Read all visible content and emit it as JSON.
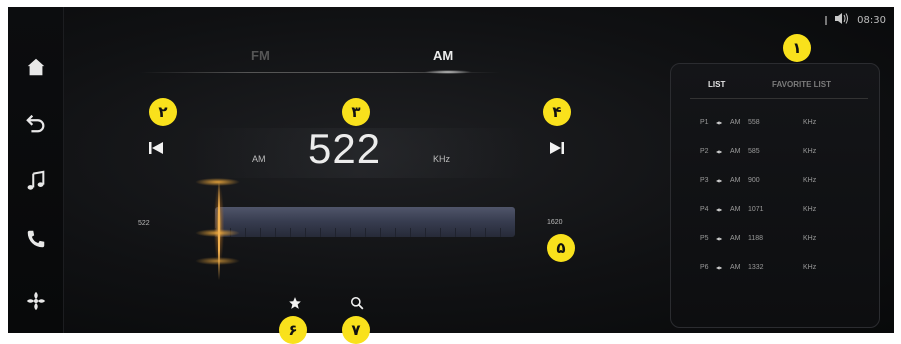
{
  "status": {
    "time": "08:30",
    "volume_icon": "volume-icon"
  },
  "sidebar": {
    "items": [
      {
        "name": "home-icon"
      },
      {
        "name": "back-icon"
      },
      {
        "name": "music-icon"
      },
      {
        "name": "phone-icon"
      },
      {
        "name": "fan-icon"
      }
    ]
  },
  "tabs": {
    "fm": "FM",
    "am": "AM"
  },
  "tuner": {
    "band_unit": "AM",
    "frequency": "522",
    "unit": "KHz",
    "scale_min": "522",
    "scale_max": "1620"
  },
  "list": {
    "tab_list": "LIST",
    "tab_favorite": "FAVORITE LIST",
    "presets": [
      {
        "num": "P1",
        "band": "AM",
        "freq": "558",
        "unit": "KHz"
      },
      {
        "num": "P2",
        "band": "AM",
        "freq": "585",
        "unit": "KHz"
      },
      {
        "num": "P3",
        "band": "AM",
        "freq": "900",
        "unit": "KHz"
      },
      {
        "num": "P4",
        "band": "AM",
        "freq": "1071",
        "unit": "KHz"
      },
      {
        "num": "P5",
        "band": "AM",
        "freq": "1188",
        "unit": "KHz"
      },
      {
        "num": "P6",
        "band": "AM",
        "freq": "1332",
        "unit": "KHz"
      }
    ]
  },
  "callouts": [
    "۱",
    "۲",
    "۳",
    "۴",
    "۵",
    "۶",
    "۷"
  ]
}
